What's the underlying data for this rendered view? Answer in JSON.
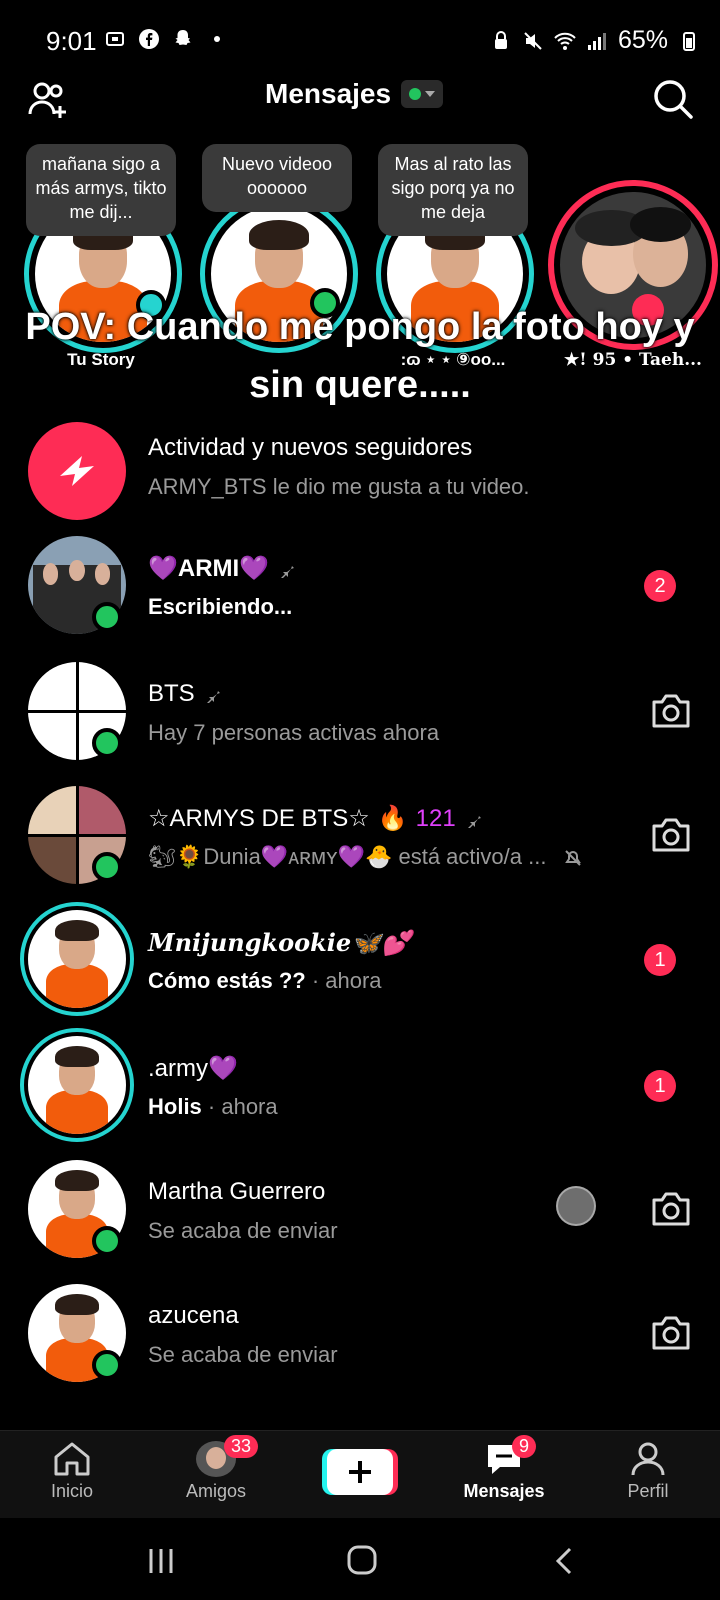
{
  "status_bar": {
    "time": "9:01",
    "battery": "65%"
  },
  "header": {
    "title": "Mensajes"
  },
  "stories": [
    {
      "bubble": "mañana sigo a más armys, tikto me dij...",
      "name": "Tu Story"
    },
    {
      "bubble": "Nuevo videoo oooooo",
      "name": ""
    },
    {
      "bubble": "Mas al rato las sigo porq ya no me deja",
      "name": ":ɷ ⋆ ⋆ ⑨oo..."
    },
    {
      "bubble": "",
      "name": "★! 95 • Taeh..."
    }
  ],
  "overlay_caption": "POV: Cuando me pongo la foto hoy y sin quere.....",
  "activity": {
    "title": "Actividad y nuevos seguidores",
    "subtitle": "ARMY_BTS le dio me gusta a tu video."
  },
  "chats": [
    {
      "name": "💜ARMI💜",
      "sub": "Escribiendo...",
      "time": "",
      "badge": "2"
    },
    {
      "name": "BTS",
      "sub": "Hay 7 personas activas ahora",
      "time": "",
      "badge": ""
    },
    {
      "name": "☆ARMYS DE BTS☆",
      "streak": "121",
      "sub": "🐿🌻Dunia💜ᴀʀᴍʏ💜🐣 está activo/a ...",
      "time": "",
      "badge": ""
    },
    {
      "name": "𝑴𝒏𝒊𝒋𝒖𝒏𝒈𝒌𝒐𝒐𝒌𝒊𝒆🦋💕",
      "sub": "Cómo estás ??",
      "time": " · ahora",
      "badge": "1"
    },
    {
      "name": ".army💜",
      "sub": "Holis",
      "time": " · ahora",
      "badge": "1"
    },
    {
      "name": "Martha Guerrero",
      "sub": "Se acaba de enviar",
      "time": "",
      "badge": ""
    },
    {
      "name": "azucena",
      "sub": "Se acaba de enviar",
      "time": "",
      "badge": ""
    }
  ],
  "bottom_nav": {
    "home": "Inicio",
    "friends": "Amigos",
    "friends_badge": "33",
    "messages": "Mensajes",
    "messages_badge": "9",
    "profile": "Perfil"
  },
  "colors": {
    "accent": "#fe2c55",
    "ring": "#25d4d0",
    "online": "#22c55e"
  }
}
